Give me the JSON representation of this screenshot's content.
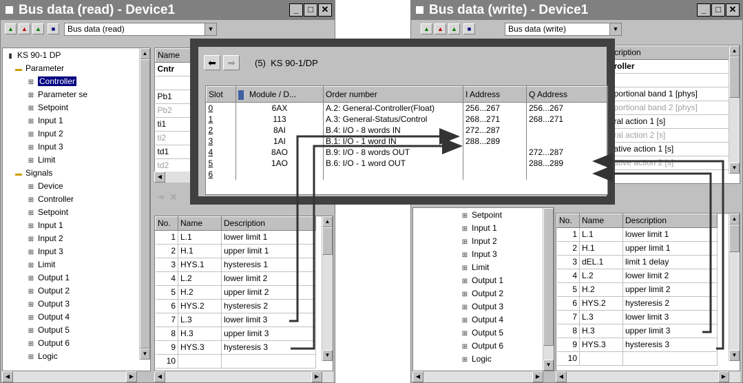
{
  "read_window": {
    "title": "Bus data (read) - Device1",
    "combo_value": "Bus data (read)",
    "tree": [
      {
        "label": "KS 90-1 DP",
        "kind": "device"
      },
      {
        "label": "Parameter",
        "kind": "folder"
      },
      {
        "label": "Controller",
        "kind": "item",
        "selected": true
      },
      {
        "label": "Parameter se",
        "kind": "item"
      },
      {
        "label": "Setpoint",
        "kind": "item"
      },
      {
        "label": "Input 1",
        "kind": "item"
      },
      {
        "label": "Input 2",
        "kind": "item"
      },
      {
        "label": "Input 3",
        "kind": "item"
      },
      {
        "label": "Limit",
        "kind": "item"
      },
      {
        "label": "Signals",
        "kind": "folder"
      },
      {
        "label": "Device",
        "kind": "item"
      },
      {
        "label": "Controller",
        "kind": "item"
      },
      {
        "label": "Setpoint",
        "kind": "item"
      },
      {
        "label": "Input 1",
        "kind": "item"
      },
      {
        "label": "Input 2",
        "kind": "item"
      },
      {
        "label": "Input 3",
        "kind": "item"
      },
      {
        "label": "Limit",
        "kind": "item"
      },
      {
        "label": "Output 1",
        "kind": "item"
      },
      {
        "label": "Output 2",
        "kind": "item"
      },
      {
        "label": "Output 3",
        "kind": "item"
      },
      {
        "label": "Output 4",
        "kind": "item"
      },
      {
        "label": "Output 5",
        "kind": "item"
      },
      {
        "label": "Output 6",
        "kind": "item"
      },
      {
        "label": "Logic",
        "kind": "item"
      }
    ],
    "upper_header": "Name",
    "upper_rows": [
      {
        "name": "Cntr",
        "bold": true
      },
      {
        "name": ""
      },
      {
        "name": "Pb1"
      },
      {
        "name": "Pb2",
        "dim": true
      },
      {
        "name": "ti1"
      },
      {
        "name": "ti2",
        "dim": true
      },
      {
        "name": "td1"
      },
      {
        "name": "td2",
        "dim": true
      }
    ],
    "lower_headers": [
      "No.",
      "Name",
      "Description"
    ],
    "lower_rows": [
      {
        "no": "1",
        "name": "L.1",
        "desc": "lower limit 1"
      },
      {
        "no": "2",
        "name": "H.1",
        "desc": "upper limit 1"
      },
      {
        "no": "3",
        "name": "HYS.1",
        "desc": "hysteresis 1"
      },
      {
        "no": "4",
        "name": "L.2",
        "desc": "lower limit 2"
      },
      {
        "no": "5",
        "name": "H.2",
        "desc": "upper limit 2"
      },
      {
        "no": "6",
        "name": "HYS.2",
        "desc": "hysteresis 2"
      },
      {
        "no": "7",
        "name": "L.3",
        "desc": "lower limit 3"
      },
      {
        "no": "8",
        "name": "H.3",
        "desc": "upper limit 3"
      },
      {
        "no": "9",
        "name": "HYS.3",
        "desc": "hysteresis 3"
      },
      {
        "no": "10",
        "name": "",
        "desc": ""
      }
    ]
  },
  "write_window": {
    "title": "Bus data (write) - Device1",
    "combo_value": "Bus data (write)",
    "tree": [
      {
        "label": "Setpoint",
        "kind": "item"
      },
      {
        "label": "Input 1",
        "kind": "item"
      },
      {
        "label": "Input 2",
        "kind": "item"
      },
      {
        "label": "Input 3",
        "kind": "item"
      },
      {
        "label": "Limit",
        "kind": "item"
      },
      {
        "label": "Output 1",
        "kind": "item"
      },
      {
        "label": "Output 2",
        "kind": "item"
      },
      {
        "label": "Output 3",
        "kind": "item"
      },
      {
        "label": "Output 4",
        "kind": "item"
      },
      {
        "label": "Output 5",
        "kind": "item"
      },
      {
        "label": "Output 6",
        "kind": "item"
      },
      {
        "label": "Logic",
        "kind": "item"
      }
    ],
    "upper_header": "cription",
    "upper_rows": [
      {
        "text": "roller",
        "bold": true
      },
      {
        "text": ""
      },
      {
        "text": "portional band 1 [phys]"
      },
      {
        "text": "portional band 2 [phys]",
        "dim": true
      },
      {
        "text": "ral action 1 [s]"
      },
      {
        "text": "ral action 2 [s]",
        "dim": true
      },
      {
        "text": "ative action 1 [s]"
      },
      {
        "text": "ative action 2 [s]",
        "dim": true
      }
    ],
    "lower_headers": [
      "No.",
      "Name",
      "Description"
    ],
    "lower_rows": [
      {
        "no": "1",
        "name": "L.1",
        "desc": "lower limit 1"
      },
      {
        "no": "2",
        "name": "H.1",
        "desc": "upper limit 1"
      },
      {
        "no": "3",
        "name": "dEL.1",
        "desc": "limit 1 delay"
      },
      {
        "no": "4",
        "name": "L.2",
        "desc": "lower limit 2"
      },
      {
        "no": "5",
        "name": "H.2",
        "desc": "upper limit 2"
      },
      {
        "no": "6",
        "name": "HYS.2",
        "desc": "hysteresis 2"
      },
      {
        "no": "7",
        "name": "L.3",
        "desc": "lower limit 3"
      },
      {
        "no": "8",
        "name": "H.3",
        "desc": "upper limit 3"
      },
      {
        "no": "9",
        "name": "HYS.3",
        "desc": "hysteresis 3"
      },
      {
        "no": "10",
        "name": "",
        "desc": ""
      }
    ]
  },
  "config_panel": {
    "station": "(5)  KS 90-1/DP",
    "headers": [
      "Slot",
      "Module / D...",
      "Order number",
      "I Address",
      "Q Address"
    ],
    "rows": [
      {
        "slot": "0",
        "module": "6AX",
        "order": "A.2: General-Controller(Float)",
        "iaddr": "256...267",
        "qaddr": "256...267"
      },
      {
        "slot": "1",
        "module": "113",
        "order": "A.3: General-Status/Control",
        "iaddr": "268...271",
        "qaddr": "268...271"
      },
      {
        "slot": "2",
        "module": "8AI",
        "order": "B.4: I/O - 8 words IN",
        "iaddr": "272...287",
        "qaddr": ""
      },
      {
        "slot": "3",
        "module": "1AI",
        "order": "B.1: I/O - 1 word IN",
        "iaddr": "288...289",
        "qaddr": ""
      },
      {
        "slot": "4",
        "module": "8AO",
        "order": "B.9: I/O - 8 words OUT",
        "iaddr": "",
        "qaddr": "272...287"
      },
      {
        "slot": "5",
        "module": "1AO",
        "order": "B.6: I/O - 1 word OUT",
        "iaddr": "",
        "qaddr": "288...289"
      },
      {
        "slot": "6",
        "module": "",
        "order": "",
        "iaddr": "",
        "qaddr": ""
      }
    ]
  },
  "icons": {
    "back": "back-arrow-icon",
    "forward": "forward-arrow-icon",
    "minimize": "minimize-icon",
    "maximize": "maximize-icon",
    "close": "close-icon"
  },
  "colors": {
    "title_bar": "#808080",
    "window_face": "#c0c0c0",
    "overlay": "#404040",
    "selection": "#000080"
  }
}
